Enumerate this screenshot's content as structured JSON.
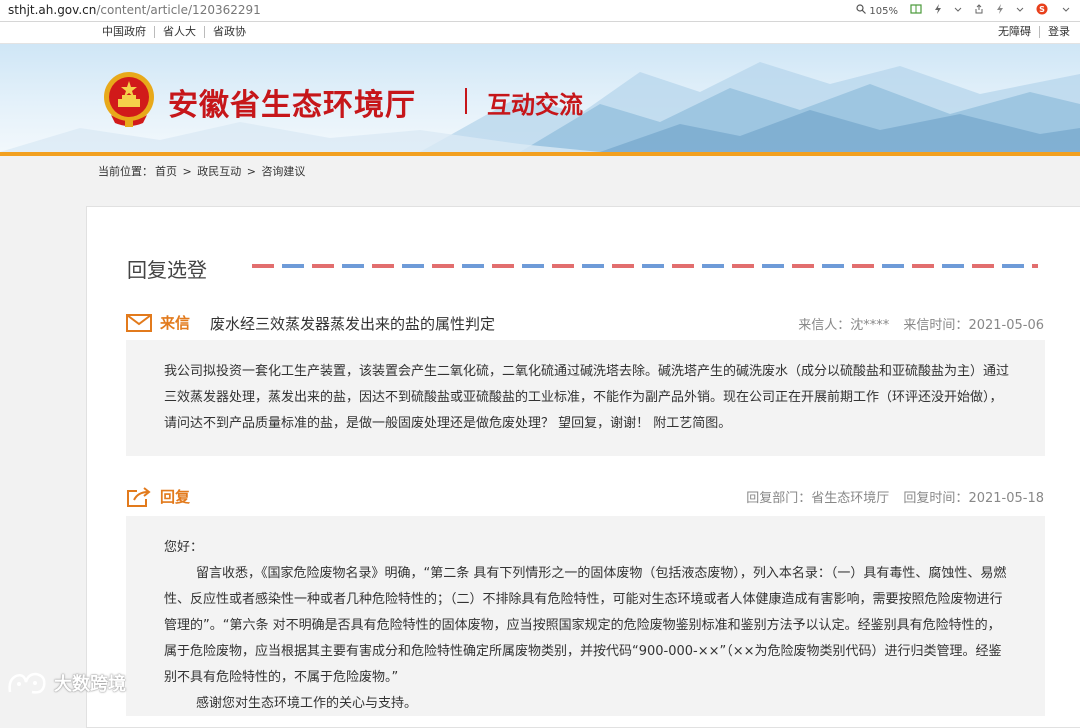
{
  "browser": {
    "url_host": "sthjt.ah.gov.cn",
    "url_path": "/content/article/120362291",
    "zoom": "105%"
  },
  "topnav": {
    "left": [
      "中国政府",
      "省人大",
      "省政协"
    ],
    "right": [
      "无障碍",
      "登录"
    ]
  },
  "header": {
    "site_title": "安徽省生态环境厅",
    "section_title": "互动交流"
  },
  "breadcrumb": {
    "prefix": "当前位置：",
    "items": [
      "首页",
      "政民互动",
      "咨询建议"
    ],
    "separator": " > "
  },
  "page": {
    "heading": "回复选登"
  },
  "letter": {
    "label": "来信",
    "title": "废水经三效蒸发器蒸发出来的盐的属性判定",
    "sender_label": "来信人：",
    "sender": "沈****",
    "date_label": "来信时间：",
    "date": "2021-05-06",
    "body": "我公司拟投资一套化工生产装置，该装置会产生二氧化硫，二氧化硫通过碱洗塔去除。碱洗塔产生的碱洗废水（成分以硫酸盐和亚硫酸盐为主）通过三效蒸发器处理，蒸发出来的盐，因达不到硫酸盐或亚硫酸盐的工业标准，不能作为副产品外销。现在公司正在开展前期工作（环评还没开始做），请问达不到产品质量标准的盐，是做一般固废处理还是做危废处理？ 望回复，谢谢！ 附工艺简图。"
  },
  "reply": {
    "label": "回复",
    "dept_label": "回复部门：",
    "dept": "省生态环境厅",
    "date_label": "回复时间：",
    "date": "2021-05-18",
    "greeting": "您好：",
    "body": "留言收悉，《国家危险废物名录》明确，“第二条 具有下列情形之一的固体废物（包括液态废物），列入本名录：（一）具有毒性、腐蚀性、易燃性、反应性或者感染性一种或者几种危险特性的；（二）不排除具有危险特性，可能对生态环境或者人体健康造成有害影响，需要按照危险废物进行管理的”。“第六条 对不明确是否具有危险特性的固体废物，应当按照国家规定的危险废物鉴别标准和鉴别方法予以认定。经鉴别具有危险特性的，属于危险废物，应当根据其主要有害成分和危险特性确定所属废物类别，并按代码“900-000-××”（××为危险废物类别代码）进行归类管理。经鉴别不具有危险特性的，不属于危险废物。”",
    "closing": "感谢您对生态环境工作的关心与支持。"
  },
  "watermark": {
    "text": "大数跨境"
  },
  "colors": {
    "brand_red": "#c6161a",
    "accent_orange": "#f2a020",
    "label_orange": "#e27a1c"
  }
}
